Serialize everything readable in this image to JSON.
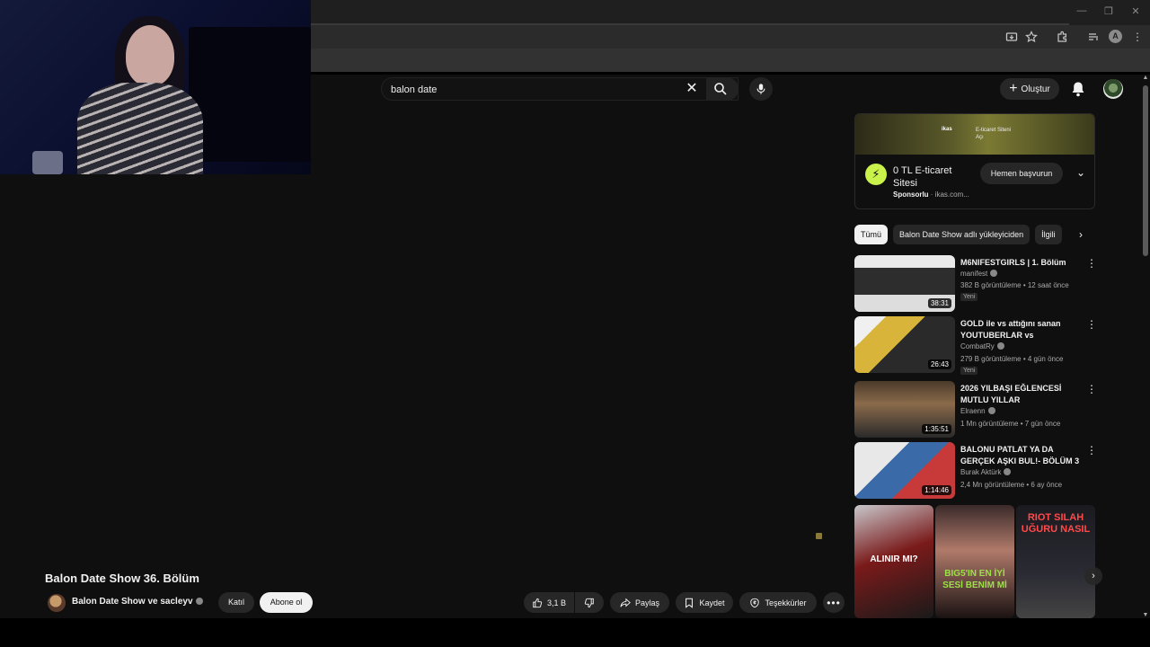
{
  "browser": {
    "window_controls": {
      "minimize": "—",
      "restore": "❐",
      "close": "✕"
    },
    "profile_initial": "A"
  },
  "search": {
    "query": "balon date"
  },
  "header": {
    "create_label": "Oluştur"
  },
  "ad": {
    "banner_brand": "ikas",
    "banner_text_line1": "E-ticaret Siteni",
    "banner_text_line2": "Açı",
    "title": "0 TL E-ticaret Sitesi",
    "sponsored_label": "Sponsorlu",
    "domain": "ikas.com...",
    "cta_label": "Hemen başvurun"
  },
  "chips": [
    {
      "label": "Tümü",
      "active": true
    },
    {
      "label": "Balon Date Show adlı yükleyiciden",
      "active": false
    },
    {
      "label": "İlgili",
      "active": false
    }
  ],
  "recommendations": [
    {
      "title": "M6NIFESTGIRLS | 1. Bölüm",
      "channel": "manifest",
      "stats": "382 B görüntüleme • 12 saat önce",
      "badge": "Yeni",
      "duration": "38:31"
    },
    {
      "title": "GOLD ile vs attığını sanan YOUTUBERLAR vs COMBATR...",
      "channel": "CombatRy",
      "stats": "279 B görüntüleme • 4 gün önce",
      "badge": "Yeni",
      "duration": "26:43"
    },
    {
      "title": "2026 YILBAŞI EĞLENCESİ MUTLU YILLAR",
      "channel": "Elraenn",
      "stats": "1 Mn görüntüleme • 7 gün önce",
      "badge": "",
      "duration": "1:35:51"
    },
    {
      "title": "BALONU PATLAT YA DA GERÇEK AŞKI BUL!- BÖLÜM 3",
      "channel": "Burak Aktürk",
      "stats": "2,4 Mn görüntüleme • 6 ay önce",
      "badge": "",
      "duration": "1:14:46"
    }
  ],
  "shorts": [
    {
      "text": "ALINIR MI?"
    },
    {
      "text": "BIG5'IN EN İYİ SESİ BENİM Mİ"
    },
    {
      "text": "RIOT SILAH UĞURU NASIL"
    }
  ],
  "video": {
    "title": "Balon Date Show 36. Bölüm",
    "channel": "Balon Date Show ve sacleyv",
    "join_label": "Katıl",
    "subscribe_label": "Abone ol",
    "likes": "3,1 B",
    "share_label": "Paylaş",
    "save_label": "Kaydet",
    "thanks_label": "Teşekkürler"
  }
}
